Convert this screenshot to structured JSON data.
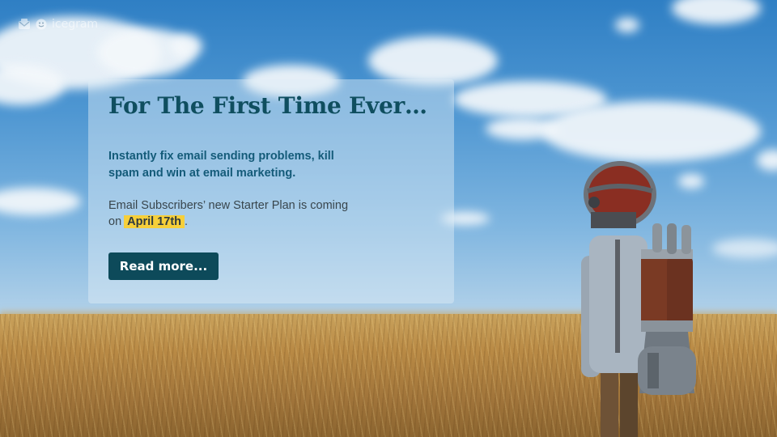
{
  "brand": {
    "logo_text": "icegram"
  },
  "campaign": {
    "headline_prefix": "For The ",
    "headline_highlight": "First Time Ever…",
    "tagline": "Instantly fix email sending problems, kill spam and win at email marketing.",
    "description": "Email Subscribers’ new Starter Plan is coming on",
    "date": "April 17th",
    "trailing_punct": ".",
    "cta_label": "Read more..."
  },
  "colors": {
    "headline": "#0f4e5f",
    "highlight_underline": "#f6cf3a",
    "tagline": "#145b79",
    "button": "#0d4a5a"
  },
  "icons": [
    "envelope-icon",
    "smiley-icon"
  ]
}
